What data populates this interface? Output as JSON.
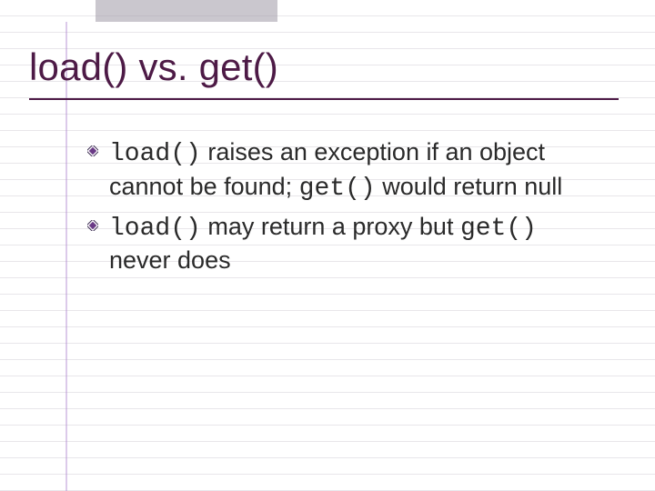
{
  "slide": {
    "title": "load() vs. get()",
    "bullets": [
      {
        "segments": [
          {
            "text": "load()",
            "mono": true
          },
          {
            "text": " raises an exception if an object cannot be found; ",
            "mono": false
          },
          {
            "text": "get()",
            "mono": true
          },
          {
            "text": " would return null",
            "mono": false
          }
        ]
      },
      {
        "segments": [
          {
            "text": "load()",
            "mono": true
          },
          {
            "text": " may return a proxy but ",
            "mono": false
          },
          {
            "text": "get()",
            "mono": true
          },
          {
            "text": " never does",
            "mono": false
          }
        ]
      }
    ]
  },
  "colors": {
    "title": "#4d1a46",
    "bullet_fill": "#6a3a86",
    "margin_line": "#b18ad0"
  }
}
